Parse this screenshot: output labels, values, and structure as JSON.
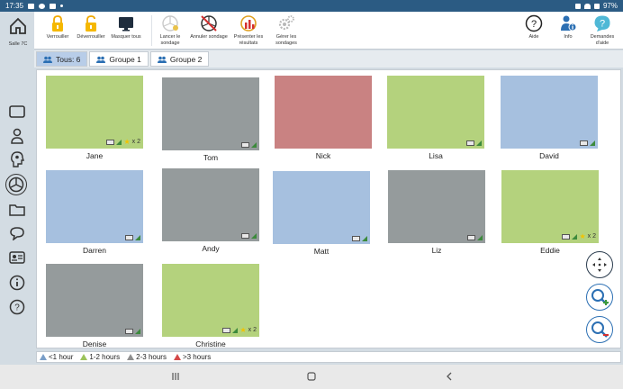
{
  "status_bar": {
    "time": "17:35",
    "battery": "97%"
  },
  "sidebar": {
    "home_label": "Salle 7C",
    "icons": [
      "screen-icon",
      "user-icon",
      "head-icon",
      "clock-icon",
      "folder-icon",
      "chat-icon",
      "id-card-icon",
      "info-icon",
      "help-icon"
    ]
  },
  "toolbar": {
    "lock": "Verrouiller",
    "unlock": "Déverrouiller",
    "hide_all": "Masquer tous",
    "launch_poll": [
      "Lancer le",
      "sondage"
    ],
    "cancel_poll": "Annuler sondage",
    "present_results": [
      "Présenter les",
      "résultats"
    ],
    "manage_polls": [
      "Gérer les",
      "sondages"
    ],
    "help": "Aide",
    "info": "Info",
    "requests": "Demandes d'aide"
  },
  "tabs": [
    {
      "label": "Tous: 6"
    },
    {
      "label": "Groupe 1"
    },
    {
      "label": "Groupe 2"
    }
  ],
  "students": [
    {
      "name": "Jane",
      "color": "#b4d27d",
      "stars": "x 2"
    },
    {
      "name": "Tom",
      "color": "#959b9c",
      "stars": ""
    },
    {
      "name": "Nick",
      "color": "#c98282",
      "stars": ""
    },
    {
      "name": "Lisa",
      "color": "#b4d27d",
      "stars": ""
    },
    {
      "name": "David",
      "color": "#a6c0df",
      "stars": ""
    },
    {
      "name": "Darren",
      "color": "#a6c0df",
      "stars": ""
    },
    {
      "name": "Andy",
      "color": "#959b9c",
      "stars": ""
    },
    {
      "name": "Matt",
      "color": "#a6c0df",
      "stars": ""
    },
    {
      "name": "Liz",
      "color": "#959b9c",
      "stars": ""
    },
    {
      "name": "Eddie",
      "color": "#b4d27d",
      "stars": "x 2"
    },
    {
      "name": "Denise",
      "color": "#959b9c",
      "stars": ""
    },
    {
      "name": "Christine",
      "color": "#b4d27d",
      "stars": "x 2"
    }
  ],
  "legend": [
    {
      "label": "<1 hour",
      "color": "#7a9ec8"
    },
    {
      "label": "1-2 hours",
      "color": "#9cc35a"
    },
    {
      "label": "2-3 hours",
      "color": "#8e8e8e"
    },
    {
      "label": ">3 hours",
      "color": "#d44848"
    }
  ]
}
